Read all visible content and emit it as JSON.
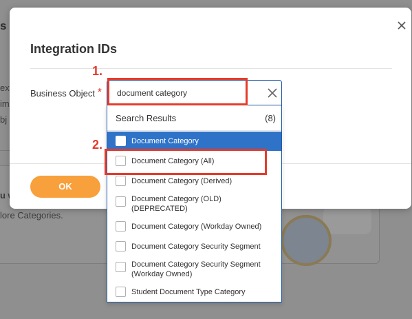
{
  "background": {
    "left_fragments": [
      "s",
      "ext",
      "im",
      "bj"
    ],
    "section_heading": "u w",
    "section_text": "lore Categories."
  },
  "modal": {
    "title": "Integration IDs",
    "close_icon": "close-icon",
    "field_label": "Business Object",
    "required_marker": "*",
    "ok_label": "OK"
  },
  "search": {
    "value": "document category",
    "clear_icon": "clear-x-icon"
  },
  "dropdown": {
    "header_label": "Search Results",
    "count": "(8)",
    "items": [
      {
        "label": "Document Category",
        "selected": true
      },
      {
        "label": "Document Category (All)",
        "selected": false
      },
      {
        "label": "Document Category (Derived)",
        "selected": false
      },
      {
        "label": "Document Category (OLD)\n(DEPRECATED)",
        "selected": false
      },
      {
        "label": "Document Category (Workday Owned)",
        "selected": false
      },
      {
        "label": "Document Category Security Segment",
        "selected": false
      },
      {
        "label": "Document Category Security Segment\n(Workday Owned)",
        "selected": false
      },
      {
        "label": "Student Document Type Category",
        "selected": false
      }
    ]
  },
  "annotations": {
    "step1": "1.",
    "step2": "2."
  },
  "colors": {
    "accent_blue": "#2f73c9",
    "ok_orange": "#f7a03c",
    "annotation_red": "#e53b2c"
  }
}
